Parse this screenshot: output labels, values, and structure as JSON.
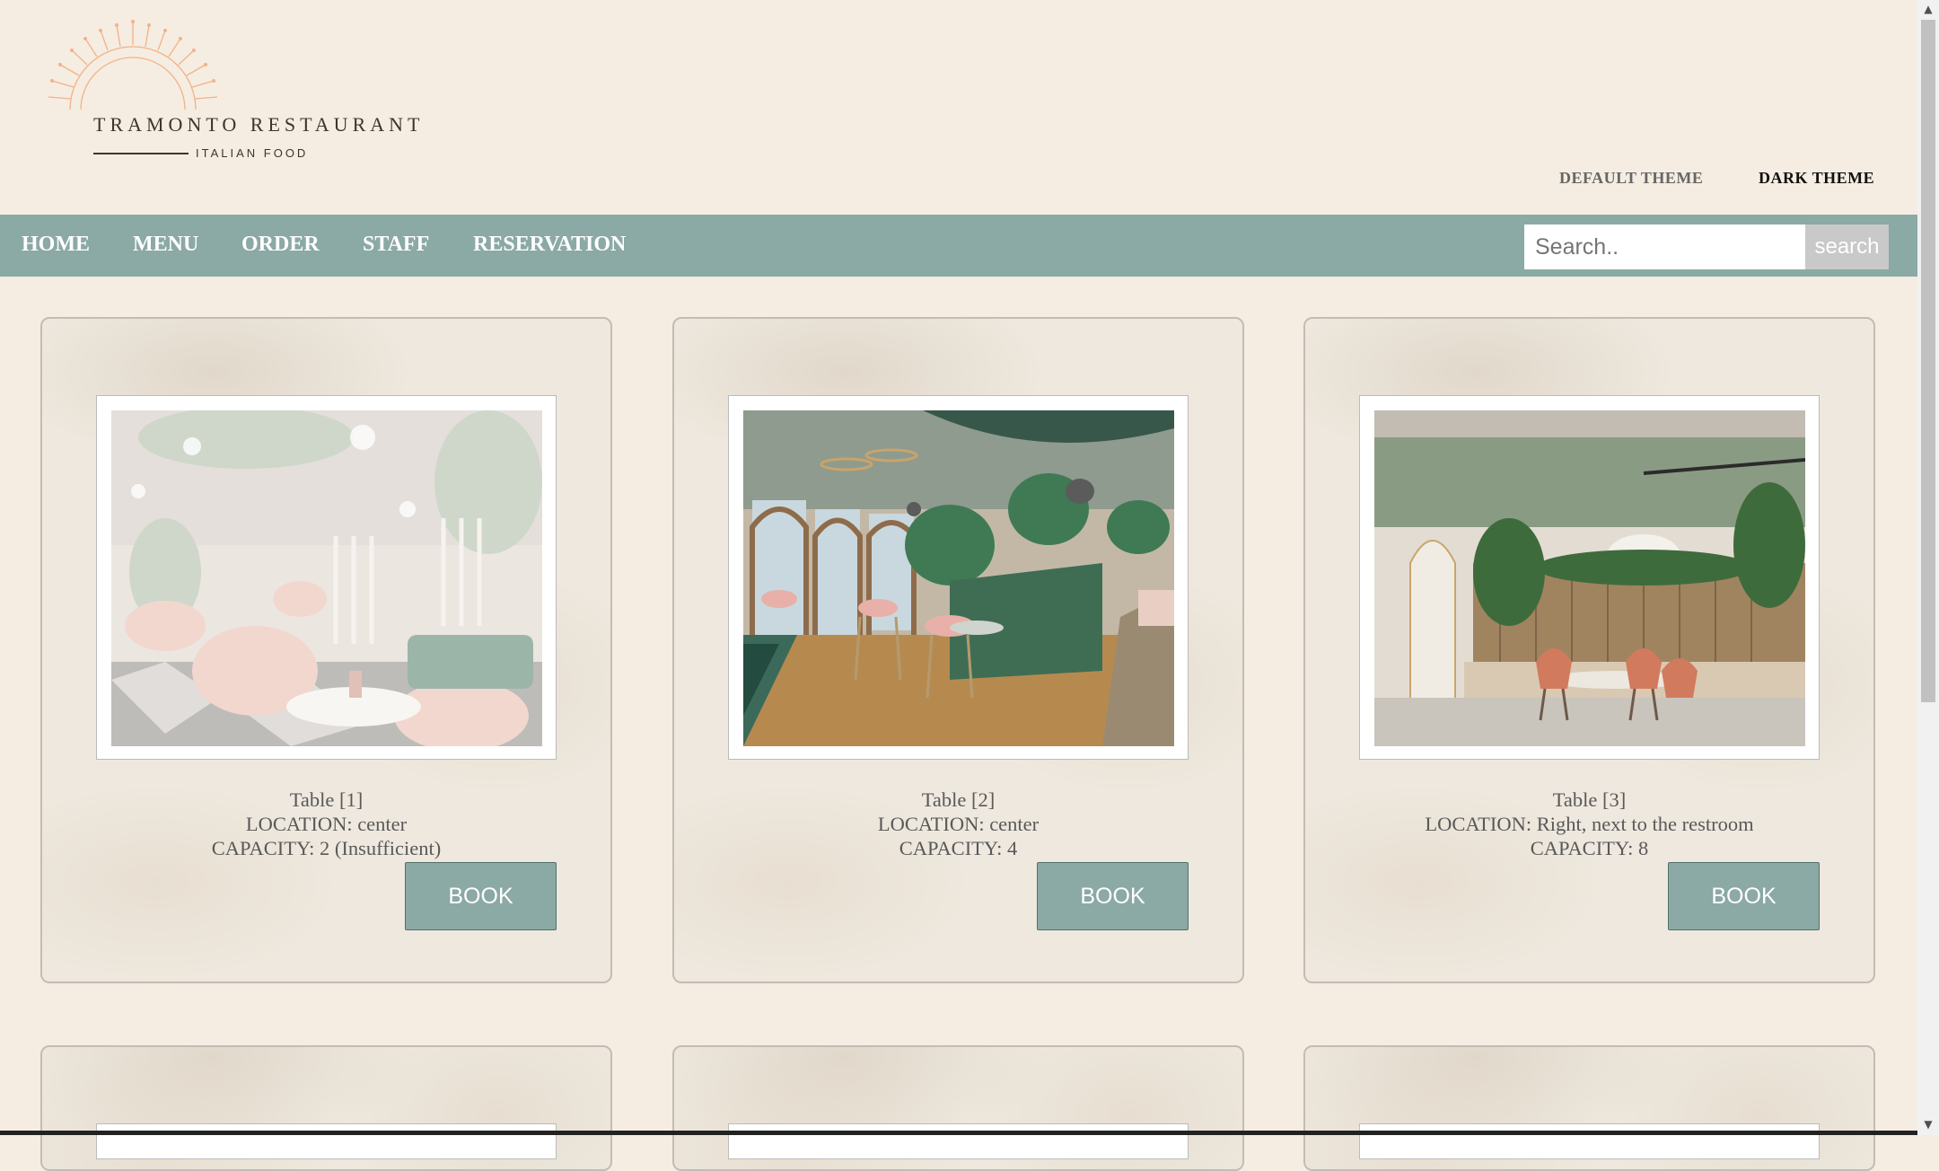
{
  "brand": {
    "name": "TRAMONTO RESTAURANT",
    "tagline": "ITALIAN FOOD",
    "accent": "#f2b28a"
  },
  "themes": {
    "default_label": "DEFAULT THEME",
    "dark_label": "DARK THEME"
  },
  "nav": {
    "items": [
      "HOME",
      "MENU",
      "ORDER",
      "STAFF",
      "RESERVATION"
    ],
    "color": "#8ba9a5"
  },
  "search": {
    "placeholder": "Search..",
    "button_label": "search"
  },
  "tables": [
    {
      "title": "Table [1]",
      "location": "LOCATION: center",
      "capacity": "CAPACITY: 2 (Insufficient)",
      "book_label": "BOOK",
      "image": "restaurant-interior-pink-chairs"
    },
    {
      "title": "Table [2]",
      "location": "LOCATION: center",
      "capacity": "CAPACITY: 4",
      "book_label": "BOOK",
      "image": "restaurant-interior-green-booth-pool"
    },
    {
      "title": "Table [3]",
      "location": "LOCATION: Right, next to the restroom",
      "capacity": "CAPACITY: 8",
      "book_label": "BOOK",
      "image": "restaurant-interior-wood-wall-orange-chairs"
    }
  ]
}
